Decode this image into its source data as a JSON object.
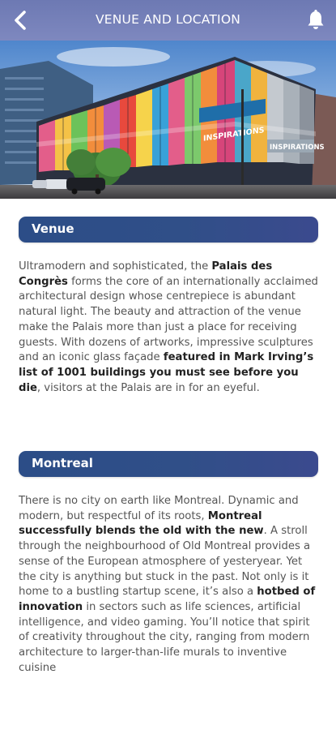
{
  "header": {
    "title": "VENUE AND LOCATION",
    "back_icon": "chevron-left-icon",
    "bell_icon": "bell-icon"
  },
  "hero_image": {
    "alt": "Palais des Congrès building with colorful glass façade",
    "sign_1": "INSPIRATIONS",
    "sign_2": "INSPIRATIONS"
  },
  "venue": {
    "heading": "Venue",
    "p1": "Ultramodern and sophisticated, the ",
    "b1": "Palais des Congrès",
    "p2": " forms the core of an internationally acclaimed architectural design whose centrepiece is abundant natural light. The beauty and attraction of the venue make the Palais more than just a place for receiving guests. With dozens of artworks, impressive sculptures and an iconic glass façade ",
    "b2": "featured in Mark Irving’s list of 1001 buildings you must see before you die",
    "p3": ", visitors at the Palais are in for an eyeful."
  },
  "montreal": {
    "heading": "Montreal",
    "p1": "There is no city on earth like Montreal. Dynamic and modern, but respectful of its roots, ",
    "b1": "Montreal successfully blends the old with the new",
    "p2": ". A stroll through the neighbourhood of Old Montreal provides a sense of the European atmosphere of yesteryear. Yet the city is anything but stuck in the past. Not only is it home to a bustling startup scene, it’s also a ",
    "b2": "hotbed of innovation",
    "p3": " in sectors such as life sciences, artificial intelligence, and video gaming. You’ll notice that spirit of creativity throughout the city, ranging from modern architecture to larger-than-life murals to inventive cuisine"
  },
  "colors": {
    "header_bg": "#737fb8",
    "section_bg": "#2e4d88",
    "body_text": "#555555"
  }
}
